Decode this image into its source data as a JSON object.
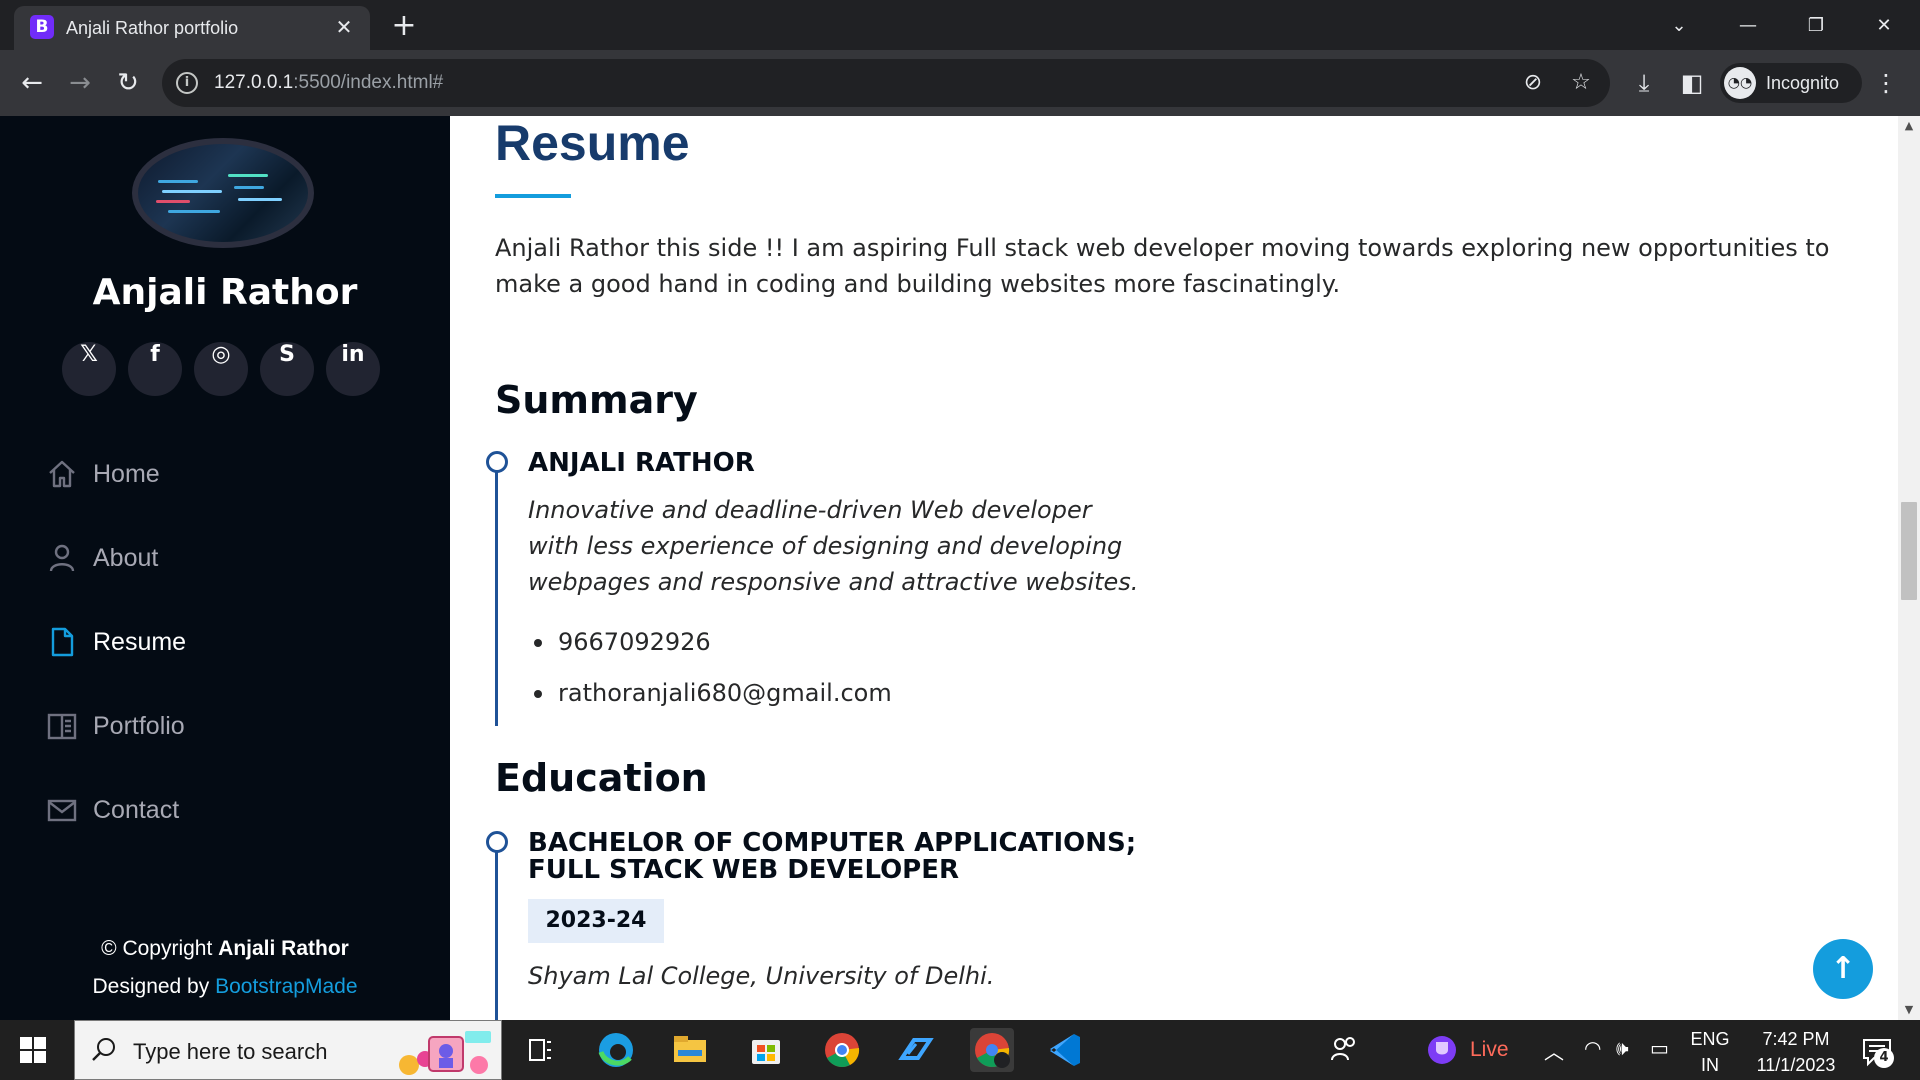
{
  "browser": {
    "tab_title": "Anjali Rathor portfolio",
    "tab_favicon": "B",
    "url_host": "127.0.0.1",
    "url_rest": ":5500/index.html#",
    "profile_label": "Incognito"
  },
  "sidebar": {
    "name": "Anjali Rathor",
    "social": [
      {
        "name": "twitter-icon",
        "glyph": "𝕏"
      },
      {
        "name": "facebook-icon",
        "glyph": "f"
      },
      {
        "name": "instagram-icon",
        "glyph": "◎"
      },
      {
        "name": "skype-icon",
        "glyph": "S"
      },
      {
        "name": "linkedin-icon",
        "glyph": "in"
      }
    ],
    "nav": [
      {
        "label": "Home",
        "icon": "home-icon"
      },
      {
        "label": "About",
        "icon": "person-icon"
      },
      {
        "label": "Resume",
        "icon": "file-icon",
        "active": true
      },
      {
        "label": "Portfolio",
        "icon": "book-icon"
      },
      {
        "label": "Contact",
        "icon": "envelope-icon"
      }
    ],
    "copyright_prefix": "© Copyright ",
    "copyright_name": "Anjali Rathor",
    "designed_prefix": "Designed by ",
    "designed_link": "BootstrapMade"
  },
  "resume": {
    "title": "Resume",
    "intro": "Anjali Rathor this side !! I am aspiring Full stack web developer moving towards exploring new opportunities to make a good hand in coding and building websites more fascinatingly.",
    "summary_heading": "Summary",
    "summary_name": "ANJALI RATHOR",
    "summary_text": "Innovative and deadline-driven Web developer with less experience of designing and developing webpages and responsive and attractive websites.",
    "contacts": [
      "9667092926",
      "rathoranjali680@gmail.com"
    ],
    "education_heading": "Education",
    "education_title": "BACHELOR OF COMPUTER APPLICATIONS; FULL STACK WEB DEVELOPER",
    "education_year": "2023-24",
    "education_school": "Shyam Lal College, University of Delhi."
  },
  "taskbar": {
    "search_placeholder": "Type here to search",
    "live_label": "Live",
    "lang_line1": "ENG",
    "lang_line2": "IN",
    "time": "7:42 PM",
    "date": "11/1/2023",
    "notification_count": "4"
  },
  "colors": {
    "accent": "#149ddd",
    "heading": "#173b6c",
    "sidebar_bg": "#040b14",
    "timeline": "#1f5297"
  }
}
